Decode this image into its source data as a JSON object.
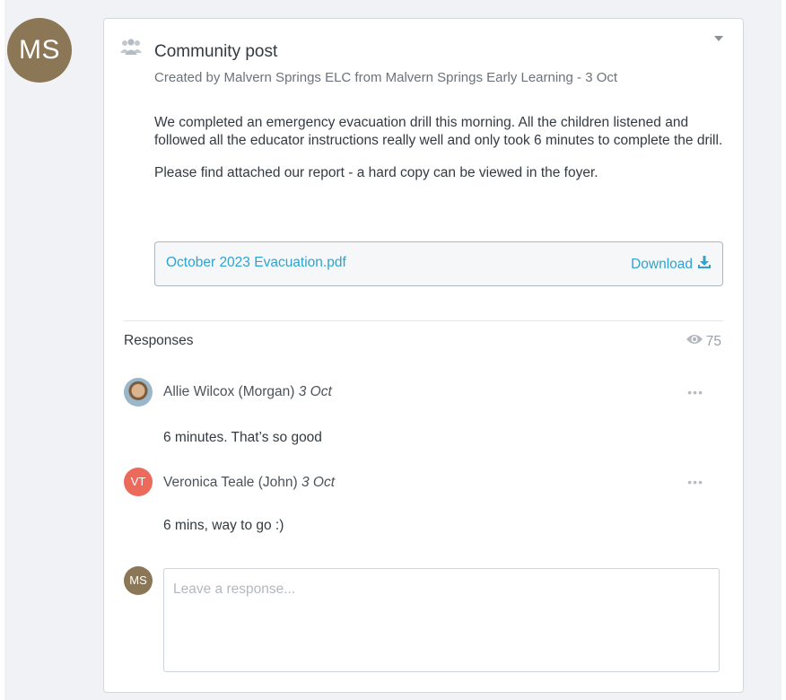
{
  "author": {
    "initials": "MS"
  },
  "post": {
    "type_icon": "group-icon",
    "title": "Community post",
    "created_line": "Created by Malvern Springs ELC from Malvern Springs Early Learning - 3 Oct",
    "body": [
      "We completed an emergency evacuation drill this morning. All the children listened and followed all the educator instructions really well and only took 6 minutes to complete the drill.",
      "Please find attached our report - a hard copy can be viewed in the foyer."
    ],
    "attachment": {
      "file_name": "October 2023 Evacuation.pdf",
      "download_label": "Download",
      "download_icon": "download-icon"
    }
  },
  "responses": {
    "label": "Responses",
    "view_count": "75",
    "view_icon": "eye-icon",
    "items": [
      {
        "avatar": "photo",
        "name": "Allie Wilcox (Morgan)",
        "date": "3 Oct",
        "text": "6 minutes. That’s so good",
        "more": "•••"
      },
      {
        "avatar": "VT",
        "name": "Veronica Teale (John)",
        "date": "3 Oct",
        "text": "6 mins, way to go :)",
        "more": "•••"
      }
    ]
  },
  "compose": {
    "initials": "MS",
    "placeholder": "Leave a response..."
  },
  "colors": {
    "accent": "#2ea3cf",
    "author_avatar": "#8b7656",
    "vt_avatar": "#ec6a5c"
  }
}
